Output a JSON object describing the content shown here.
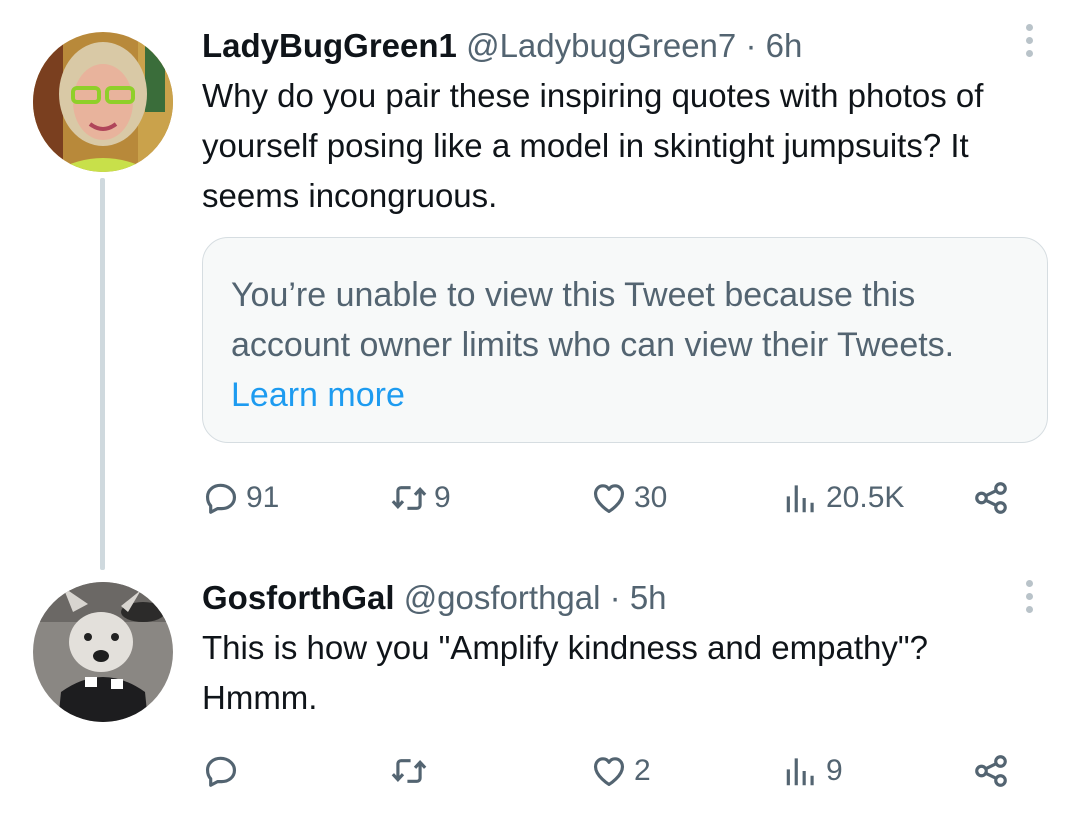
{
  "tweets": [
    {
      "display_name": "LadyBugGreen1",
      "handle": "@LadybugGreen7",
      "separator": "·",
      "time": "6h",
      "text": "Why do you pair these inspiring quotes with photos of yourself posing like a model in skintight jumpsuits? It seems incongruous.",
      "quoted_notice": {
        "text": "You’re unable to view this Tweet because this account owner limits who can view their Tweets.",
        "link": "Learn more"
      },
      "stats": {
        "replies": "91",
        "retweets": "9",
        "likes": "30",
        "views": "20.5K"
      }
    },
    {
      "display_name": "GosforthGal",
      "handle": "@gosforthgal",
      "separator": "·",
      "time": "5h",
      "text": "This is how you \"Amplify kindness and empathy\"? Hmmm.",
      "stats": {
        "replies": "",
        "retweets": "",
        "likes": "2",
        "views": "9"
      }
    }
  ],
  "icons": {
    "reply": "reply-icon",
    "retweet": "retweet-icon",
    "like": "heart-icon",
    "views": "views-icon",
    "share": "share-icon",
    "more": "more-options-icon"
  },
  "colors": {
    "text_primary": "#0f1419",
    "text_secondary": "#536471",
    "link": "#1d9bf0",
    "thread_line": "#cfd9de",
    "notice_bg": "#f7f9f9"
  }
}
